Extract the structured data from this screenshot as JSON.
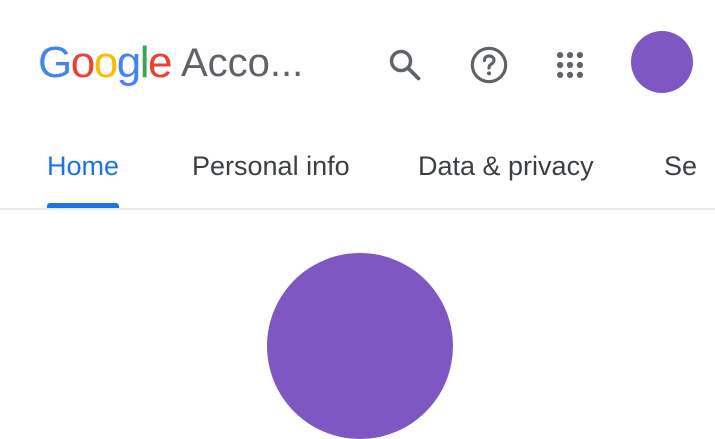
{
  "header": {
    "logo": {
      "letters": [
        "G",
        "o",
        "o",
        "g",
        "l",
        "e"
      ],
      "colors": [
        "#4285f4",
        "#ea4335",
        "#fbbc05",
        "#4285f4",
        "#34a853",
        "#ea4335"
      ]
    },
    "app_name": "Acco...",
    "icons": {
      "search": "search-icon",
      "help": "help-icon",
      "apps": "apps-grid-icon"
    },
    "avatar_color": "#7e57c2"
  },
  "tabs": [
    {
      "label": "Home",
      "active": true
    },
    {
      "label": "Personal info",
      "active": false
    },
    {
      "label": "Data & privacy",
      "active": false
    },
    {
      "label": "Se",
      "active": false
    }
  ],
  "profile": {
    "avatar_color": "#7e57c2"
  },
  "colors": {
    "accent": "#1a73e8",
    "text": "#3c4043",
    "icon": "#5f6368",
    "divider": "#e8eaed"
  }
}
